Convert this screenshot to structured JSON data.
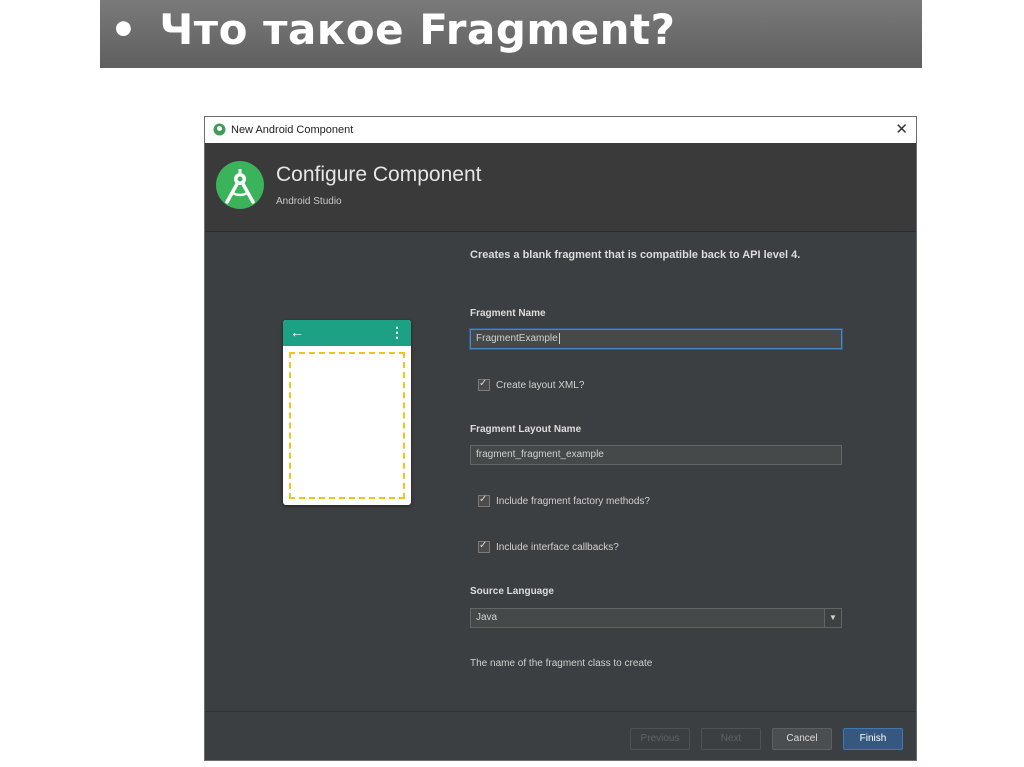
{
  "slide": {
    "bullet": "•",
    "title": "Что такое Fragment?"
  },
  "dialog": {
    "window_title": "New Android Component",
    "close_symbol": "✕",
    "header": {
      "title": "Configure Component",
      "subtitle": "Android Studio"
    },
    "description": "Creates a blank fragment that is compatible back to API level 4.",
    "fragment_name": {
      "label": "Fragment Name",
      "value": "FragmentExample"
    },
    "create_layout_xml": {
      "label": "Create layout XML?",
      "checked": true
    },
    "fragment_layout_name": {
      "label": "Fragment Layout Name",
      "value": "fragment_fragment_example"
    },
    "include_factory_methods": {
      "label": "Include fragment factory methods?",
      "checked": true
    },
    "include_interface_callbacks": {
      "label": "Include interface callbacks?",
      "checked": true
    },
    "source_language": {
      "label": "Source Language",
      "value": "Java"
    },
    "hint": "The name of the fragment class to create",
    "buttons": {
      "previous": "Previous",
      "next": "Next",
      "cancel": "Cancel",
      "finish": "Finish"
    },
    "preview": {
      "back_icon": "←",
      "menu_icon": "⋮"
    }
  },
  "colors": {
    "accent": "#1da185",
    "placeholder_border": "#f0c419",
    "dialog_bg": "#3c3f41",
    "primary_button": "#365880"
  }
}
